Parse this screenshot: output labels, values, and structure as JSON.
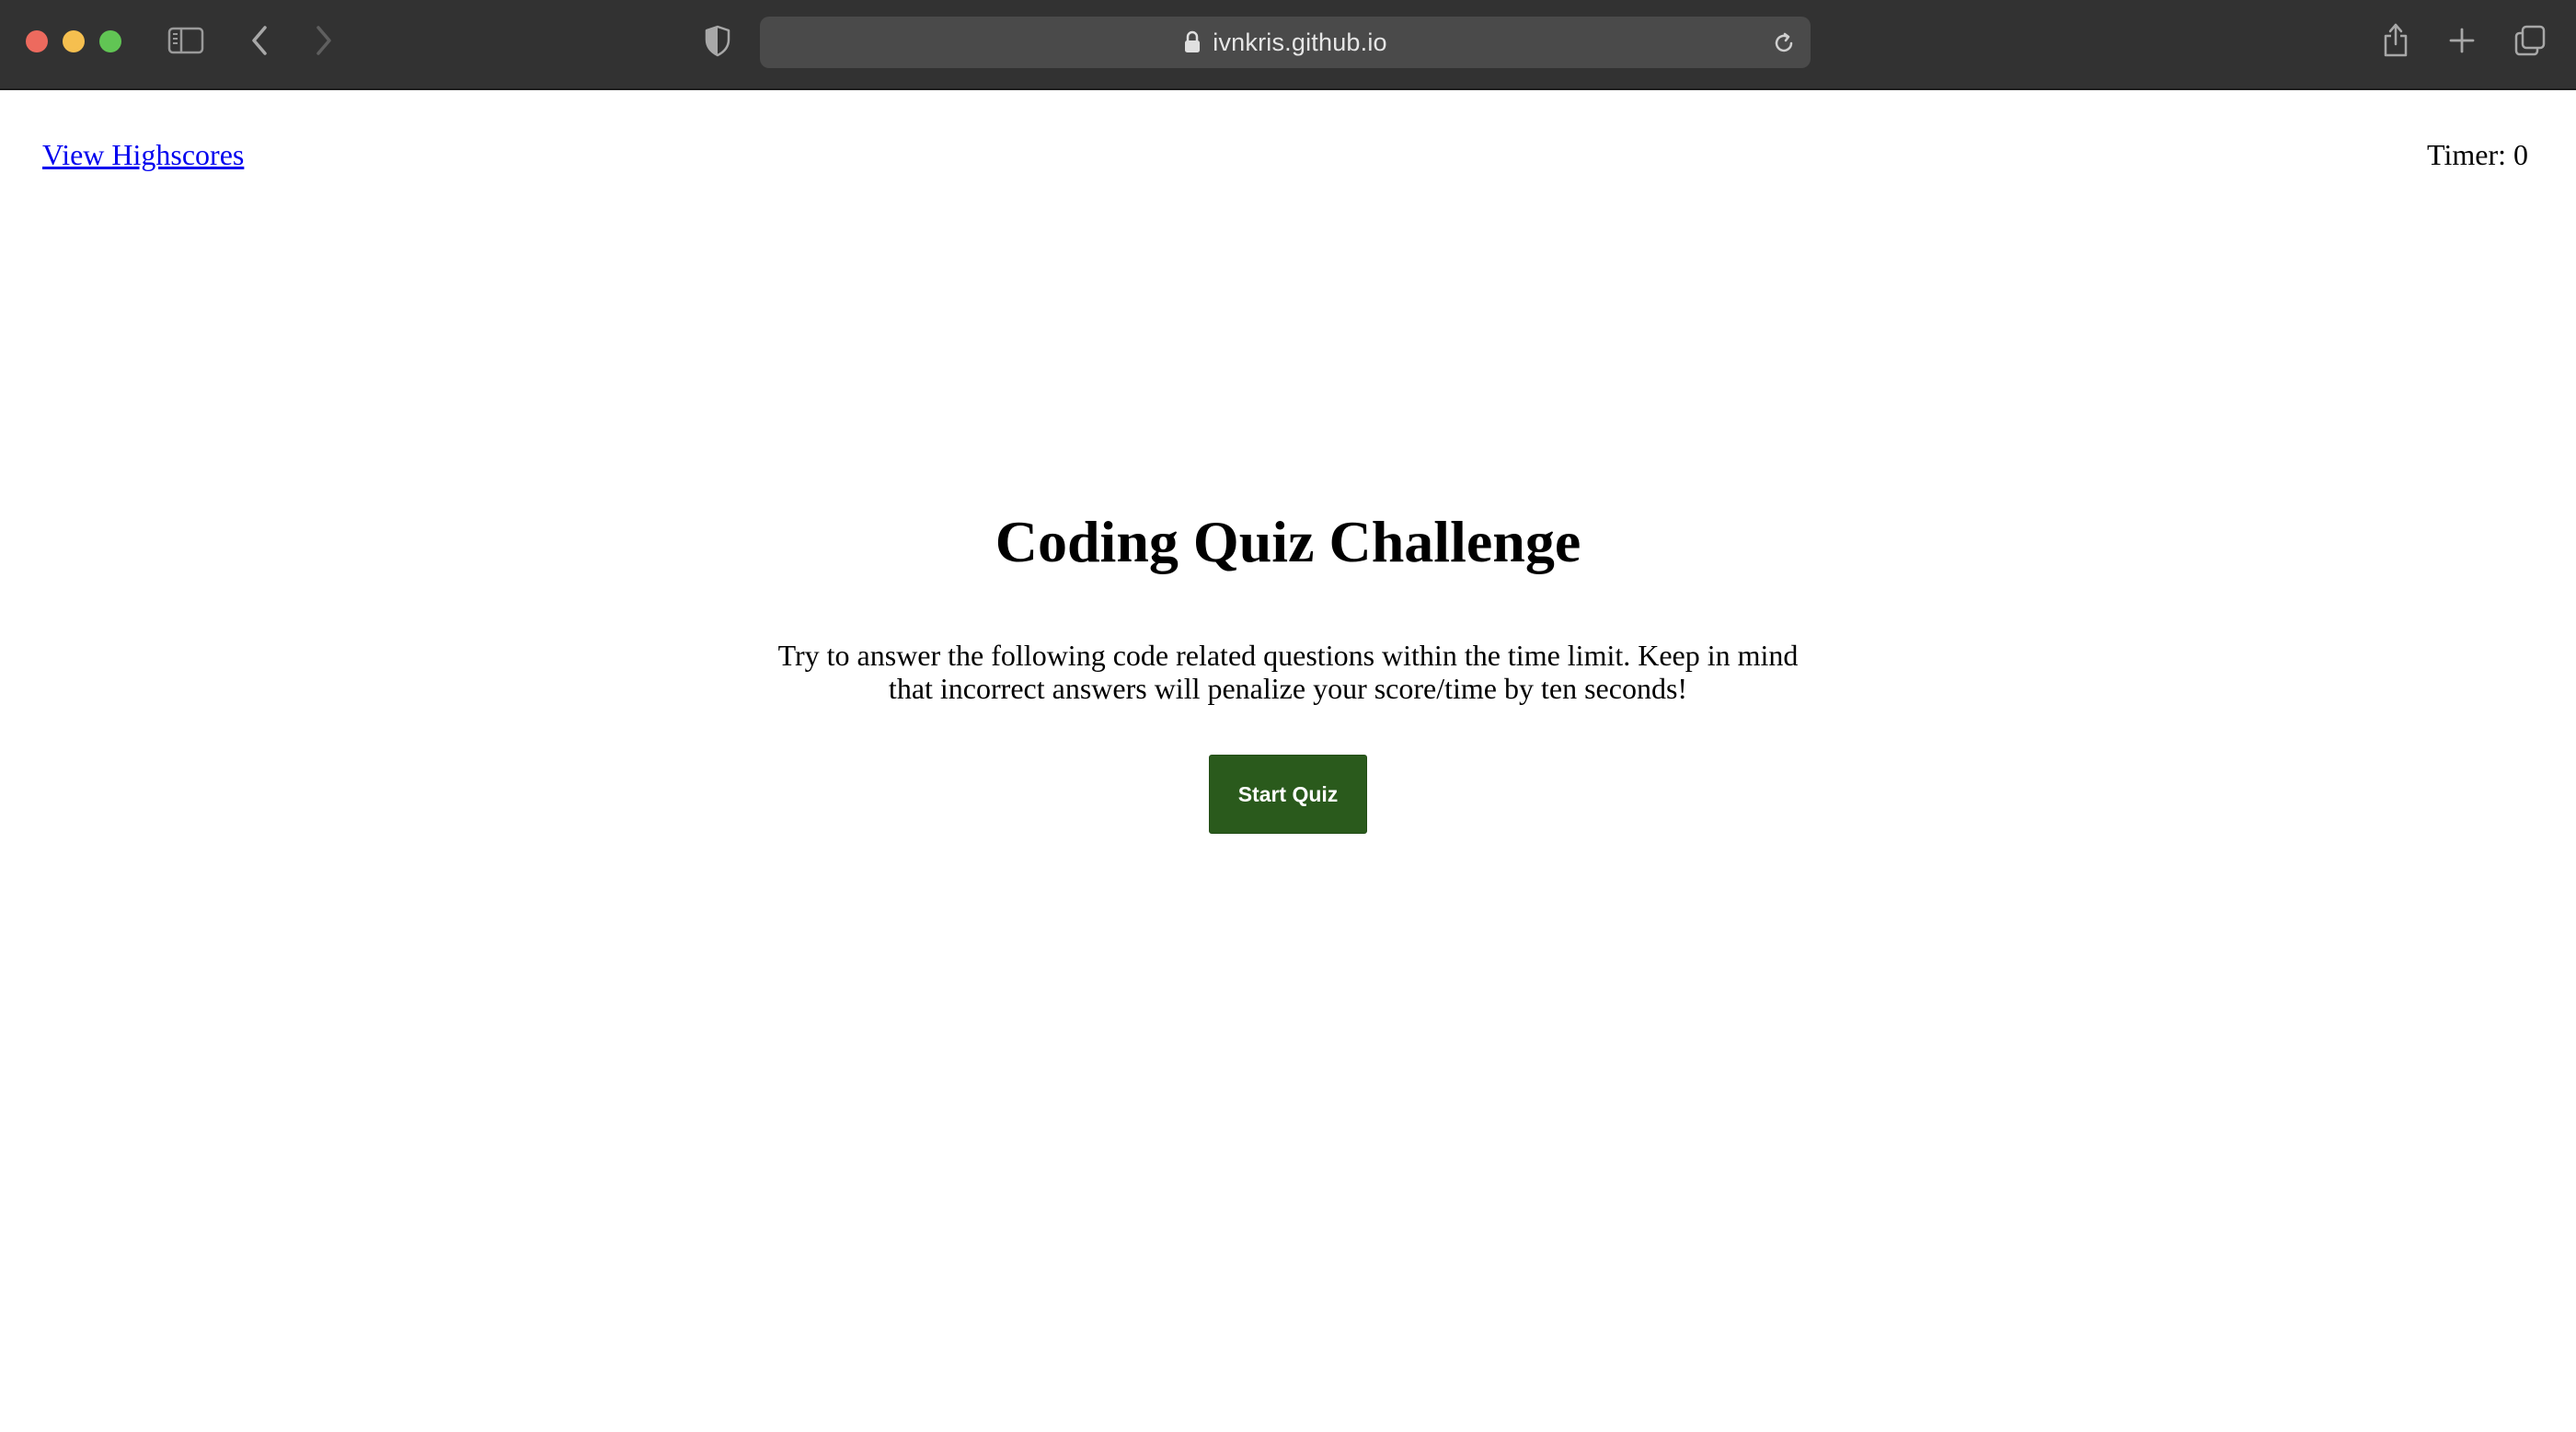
{
  "browser": {
    "url": "ivnkris.github.io",
    "icons": {
      "sidebar": "sidebar-icon",
      "back": "chevron-left-icon",
      "forward": "chevron-right-icon",
      "privacy": "shield-icon",
      "lock": "lock-icon",
      "reload": "reload-icon",
      "share": "share-icon",
      "new_tab": "plus-icon",
      "tab_overview": "tabs-icon"
    },
    "colors": {
      "toolbar": "#323232",
      "address_bar": "#4a4a4a",
      "close": "#ed6a5e",
      "minimize": "#f5bf4f",
      "zoom": "#61c554"
    }
  },
  "header": {
    "highscores_link": "View Highscores",
    "timer_label": "Timer:",
    "timer_value": "0"
  },
  "main": {
    "title": "Coding Quiz Challenge",
    "description": "Try to answer the following code related questions within the time limit. Keep in mind that incorrect answers will penalize your score/time by ten seconds!",
    "start_button": "Start Quiz",
    "colors": {
      "start_button_bg": "#2a5a1c",
      "link": "#0000ee"
    }
  }
}
